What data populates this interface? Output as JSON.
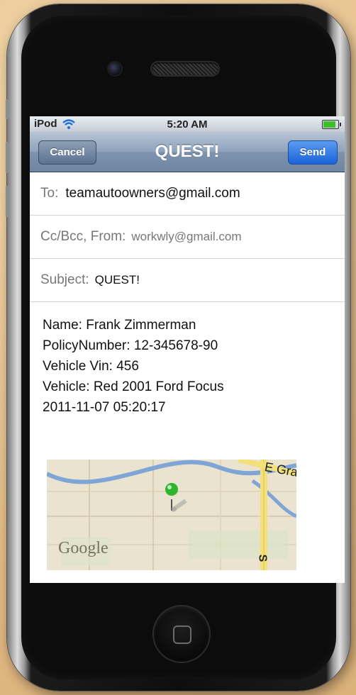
{
  "status_bar": {
    "carrier": "iPod",
    "time": "5:20 AM"
  },
  "nav": {
    "title": "QUEST!",
    "cancel_label": "Cancel",
    "send_label": "Send"
  },
  "fields": {
    "to_label": "To:",
    "to_value": "teamautoowners@gmail.com",
    "ccbcc_label": "Cc/Bcc, From:",
    "from_value": "workwly@gmail.com",
    "subject_label": "Subject:",
    "subject_value": "QUEST!"
  },
  "message_body": [
    "Name: Frank Zimmerman",
    "PolicyNumber: 12-345678-90",
    "Vehicle Vin: 456",
    "Vehicle: Red 2001 Ford Focus",
    "2011-11-07 05:20:17"
  ],
  "map": {
    "attribution": "Google",
    "street_label_top": "E Gra",
    "street_label_right": "S",
    "pin_color": "#2db52d"
  },
  "colors": {
    "send_button": "#1a64d8",
    "nav_bar": "#7d93ae",
    "battery": "#3fbf2a"
  }
}
